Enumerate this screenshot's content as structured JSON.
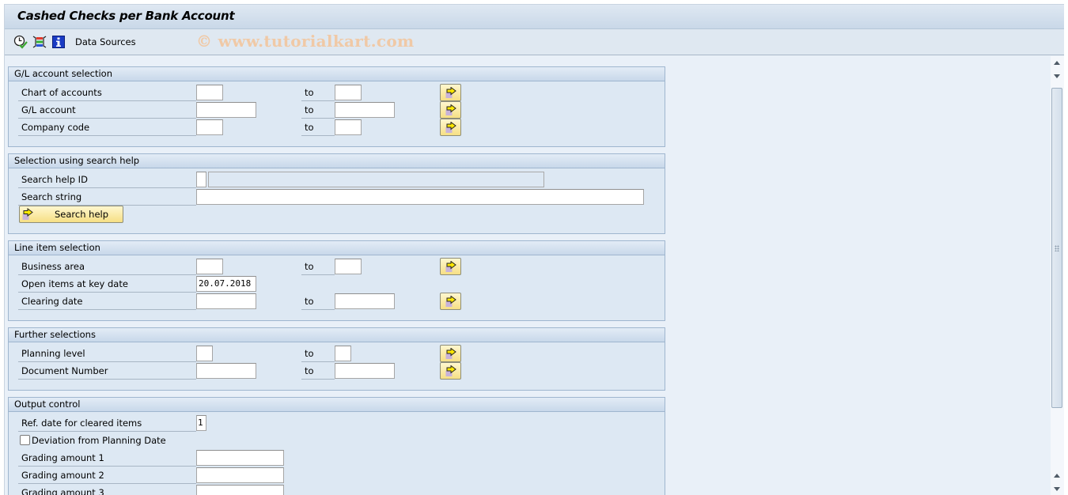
{
  "window": {
    "title": "Cashed Checks per Bank Account"
  },
  "toolbar": {
    "icons": [
      "execute-and-check-icon",
      "selection-options-icon",
      "information-icon"
    ],
    "data_sources_label": "Data Sources",
    "watermark": "© www.tutorialkart.com"
  },
  "groups": {
    "gl_account": {
      "title": "G/L account selection",
      "rows": [
        {
          "label": "Chart of accounts",
          "to_label": "to",
          "from_value": "",
          "to_value": ""
        },
        {
          "label": "G/L account",
          "to_label": "to",
          "from_value": "",
          "to_value": ""
        },
        {
          "label": "Company code",
          "to_label": "to",
          "from_value": "",
          "to_value": ""
        }
      ]
    },
    "search_help": {
      "title": "Selection using search help",
      "search_help_id_label": "Search help ID",
      "search_help_id_value": "",
      "search_help_id_desc": "",
      "search_string_label": "Search string",
      "search_string_value": "",
      "search_help_button": "Search help"
    },
    "line_item": {
      "title": "Line item selection",
      "rows": [
        {
          "label": "Business area",
          "to_label": "to",
          "from_value": "",
          "to_value": ""
        },
        {
          "label": "Open items at key date",
          "value": "20.07.2018"
        },
        {
          "label": "Clearing date",
          "to_label": "to",
          "from_value": "",
          "to_value": ""
        }
      ]
    },
    "further": {
      "title": "Further selections",
      "rows": [
        {
          "label": "Planning level",
          "to_label": "to",
          "from_value": "",
          "to_value": ""
        },
        {
          "label": "Document Number",
          "to_label": "to",
          "from_value": "",
          "to_value": ""
        }
      ]
    },
    "output": {
      "title": "Output control",
      "ref_date_label": "Ref. date for cleared items",
      "ref_date_value": "1",
      "deviation_label": "Deviation from Planning Date",
      "deviation_checked": false,
      "grading": [
        {
          "label": "Grading amount 1",
          "value": ""
        },
        {
          "label": "Grading amount 2",
          "value": ""
        },
        {
          "label": "Grading amount 3",
          "value": ""
        }
      ]
    }
  },
  "colors": {
    "background": "#e9f0f8",
    "group_bg": "#dde8f3",
    "button_yellow": "#f6df84",
    "watermark": "#f0c9a6"
  }
}
